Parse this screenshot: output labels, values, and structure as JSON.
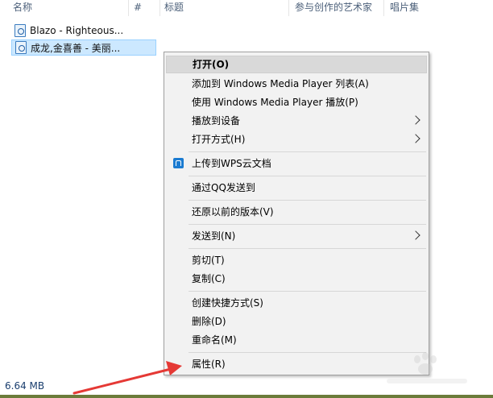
{
  "columns": {
    "name": "名称",
    "number": "#",
    "title": "标题",
    "artist": "参与创作的艺术家",
    "album": "唱片集"
  },
  "files": [
    {
      "name": "Blazo - Righteous...",
      "selected": false
    },
    {
      "name": "成龙,金喜善 - 美丽...",
      "selected": true
    }
  ],
  "context_menu": {
    "items": [
      {
        "label": "打开(O)",
        "bold": true,
        "highlighted": true
      },
      {
        "label": "添加到 Windows Media Player 列表(A)"
      },
      {
        "label": "使用 Windows Media Player 播放(P)"
      },
      {
        "label": "播放到设备",
        "submenu": true
      },
      {
        "label": "打开方式(H)",
        "submenu": true
      },
      {
        "label": "上传到WPS云文档",
        "icon": "wps-cloud-icon"
      },
      {
        "label": "通过QQ发送到"
      },
      {
        "label": "还原以前的版本(V)"
      },
      {
        "label": "发送到(N)",
        "submenu": true
      },
      {
        "label": "剪切(T)"
      },
      {
        "label": "复制(C)"
      },
      {
        "label": "创建快捷方式(S)"
      },
      {
        "label": "删除(D)"
      },
      {
        "label": "重命名(M)"
      },
      {
        "label": "属性(R)"
      }
    ]
  },
  "status_bar": {
    "size": "6.64 MB"
  },
  "colors": {
    "menu_bg": "#f2f2f2",
    "highlight": "#d9d9d9",
    "selection": "#cce8ff",
    "arrow": "#e53935",
    "wps_blue": "#1b7bd1"
  }
}
